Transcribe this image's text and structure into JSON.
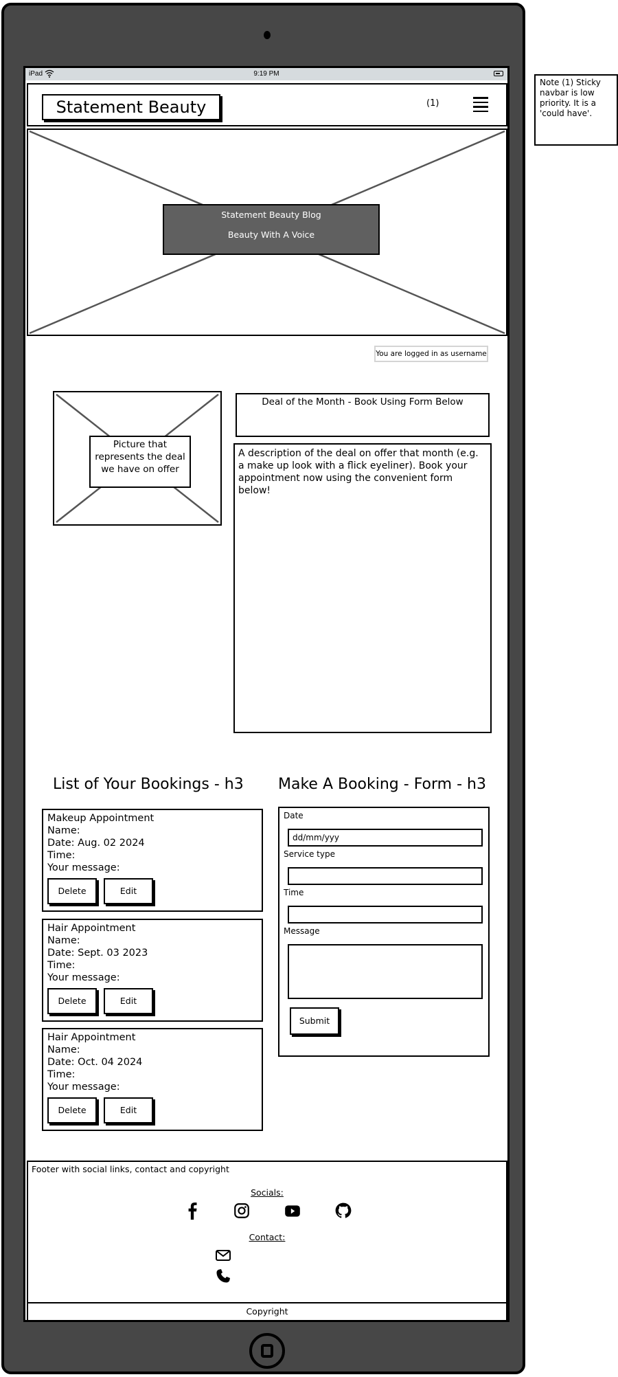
{
  "device": {
    "status_bar": {
      "device_label": "iPad",
      "time": "9:19 PM"
    }
  },
  "navbar": {
    "brand": "Statement Beauty",
    "note_ref": "(1)",
    "menu_icon": "hamburger-icon"
  },
  "hero": {
    "title": "Statement Beauty Blog",
    "tagline": "Beauty With A Voice"
  },
  "login_status": "You are logged in as username",
  "deal": {
    "image_caption": "Picture that represents the deal we have on offer",
    "title": "Deal of the Month - Book Using Form Below",
    "description": "A description of the deal on offer that month (e.g. a make up look with a flick eyeliner). Book your appointment now using the convenient form below!"
  },
  "bookings": {
    "heading": "List of Your Bookings - h3",
    "items": [
      {
        "service": "Makeup Appointment",
        "name": "Name:",
        "date": "Date: Aug. 02 2024",
        "time": "Time:",
        "message": "Your message:",
        "delete_label": "Delete",
        "edit_label": "Edit"
      },
      {
        "service": "Hair Appointment",
        "name": "Name:",
        "date": "Date: Sept. 03 2023",
        "time": "Time:",
        "message": "Your message:",
        "delete_label": "Delete",
        "edit_label": "Edit"
      },
      {
        "service": "Hair Appointment",
        "name": "Name:",
        "date": "Date: Oct. 04 2024",
        "time": "Time:",
        "message": "Your message:",
        "delete_label": "Delete",
        "edit_label": "Edit"
      }
    ]
  },
  "booking_form": {
    "heading": "Make A Booking - Form - h3",
    "date_label": "Date",
    "date_placeholder": "dd/mm/yyy",
    "service_label": "Service type",
    "service_value": "",
    "time_label": "Time",
    "time_value": "",
    "message_label": "Message",
    "message_value": "",
    "submit_label": "Submit"
  },
  "footer": {
    "note": "Footer with social links, contact and copyright",
    "socials_heading": "Socials:",
    "socials": [
      "facebook-icon",
      "instagram-icon",
      "youtube-icon",
      "github-icon"
    ],
    "contact_heading": "Contact:",
    "contacts": [
      "envelope-icon",
      "phone-icon"
    ],
    "copyright": "Copyright"
  },
  "annotation_note": "Note (1) Sticky navbar is low priority. It is a 'could have'."
}
